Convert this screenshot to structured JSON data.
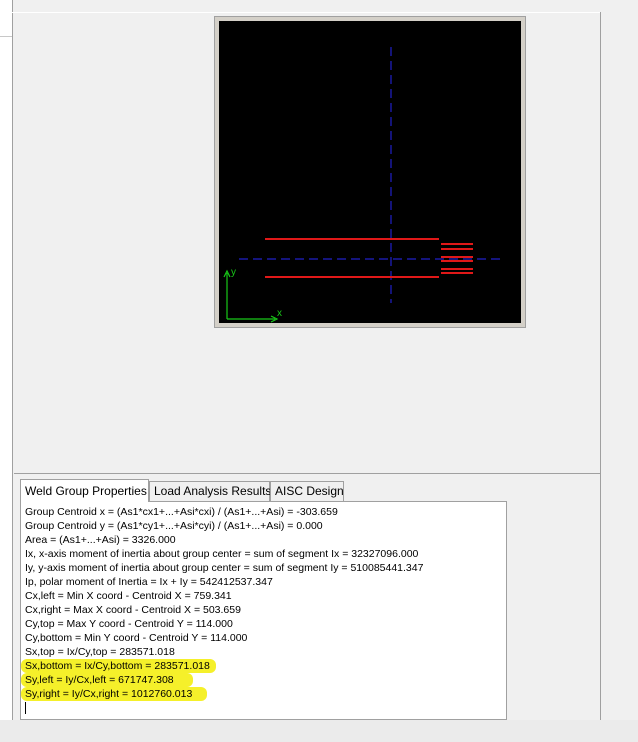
{
  "tabs": [
    {
      "label": "Weld Group Properties",
      "active": true
    },
    {
      "label": "Load Analysis Results",
      "active": false
    },
    {
      "label": "AISC Design",
      "active": false
    }
  ],
  "properties_lines": [
    "Group Centroid x = (As1*cx1+...+Asi*cxi) / (As1+...+Asi) = -303.659",
    "Group Centroid y = (As1*cy1+...+Asi*cyi) / (As1+...+Asi) = 0.000",
    "Area = (As1+...+Asi) = 3326.000",
    "Ix, x-axis moment of inertia about group center = sum of segment Ix = 32327096.000",
    "Iy, y-axis moment of inertia about group center = sum of segment Iy = 510085441.347",
    "Ip, polar moment of Inertia = Ix + Iy = 542412537.347",
    "Cx,left = Min X coord - Centroid X = 759.341",
    "Cx,right = Max X coord - Centroid X = 503.659",
    "Cy,top = Max Y coord - Centroid Y = 114.000",
    "Cy,bottom = Min Y coord - Centroid Y = 114.000",
    "Sx,top = Ix/Cy,top = 283571.018",
    "Sx,bottom = Ix/Cy,bottom = 283571.018",
    "Sy,left = Iy/Cx,left = 671747.308",
    "Sy,right = Iy/Cx,right = 1012760.013"
  ],
  "highlight_color": "#f5f02a",
  "canvas": {
    "background": "#000000",
    "weld_color": "#e01818",
    "axis_color": "#2020c8",
    "ucs_color": "#18c818",
    "ucs_x_label": "x",
    "ucs_y_label": "y"
  }
}
